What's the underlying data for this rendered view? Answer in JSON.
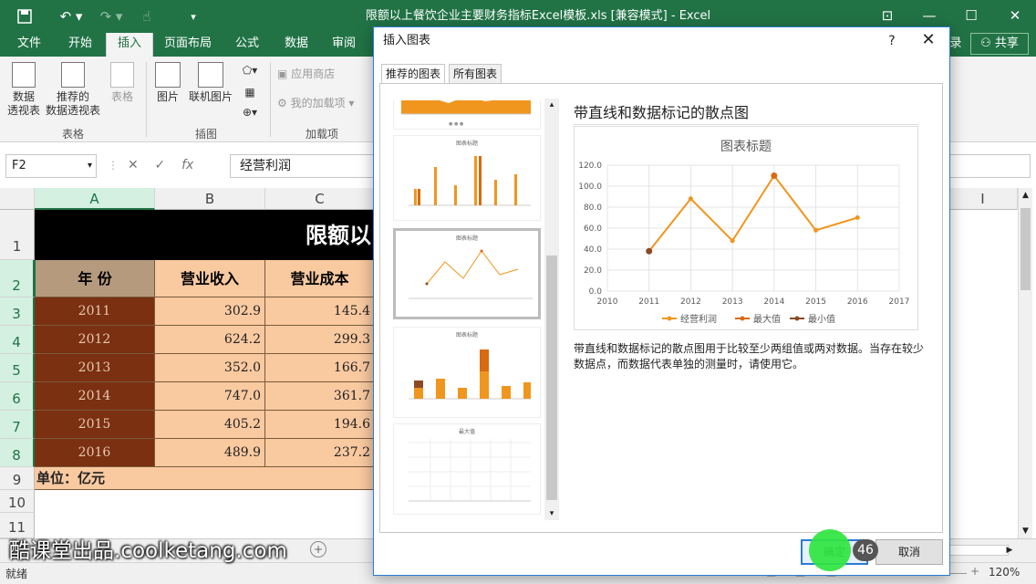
{
  "window": {
    "title": "限额以上餐饮企业主要财务指标Excel模板.xls  [兼容模式]  -  Excel",
    "share_label": "共享",
    "login_label": "录"
  },
  "ribbon": {
    "tabs": [
      "文件",
      "开始",
      "插入",
      "页面布局",
      "公式",
      "数据",
      "审阅"
    ],
    "active_tab": "插入",
    "buttons": {
      "pivot": "数据\n透视表",
      "recommended_pivot": "推荐的\n数据透视表",
      "table": "表格",
      "picture": "图片",
      "online_picture": "联机图片",
      "app_store": "应用商店",
      "my_addins": "我的加载项"
    },
    "groups": {
      "tables": "表格",
      "illustrations": "插图",
      "addins": "加载项"
    }
  },
  "formula_bar": {
    "name_box": "F2",
    "fx": "fx",
    "value": "经营利润"
  },
  "sheet": {
    "columns": [
      "A",
      "B",
      "C",
      "I"
    ],
    "rows": [
      "1",
      "2",
      "3",
      "4",
      "5",
      "6",
      "7",
      "8",
      "9",
      "10",
      "11"
    ],
    "title": "限额以",
    "headers": {
      "year": "年    份",
      "revenue": "营业收入",
      "cost": "营业成本"
    },
    "data": [
      {
        "year": "2011",
        "revenue": "302.9",
        "cost": "145.4"
      },
      {
        "year": "2012",
        "revenue": "624.2",
        "cost": "299.3"
      },
      {
        "year": "2013",
        "revenue": "352.0",
        "cost": "166.7"
      },
      {
        "year": "2014",
        "revenue": "747.0",
        "cost": "361.7"
      },
      {
        "year": "2015",
        "revenue": "405.2",
        "cost": "194.6"
      },
      {
        "year": "2016",
        "revenue": "489.9",
        "cost": "237.2"
      }
    ],
    "unit": "单位：亿元"
  },
  "status": {
    "ready": "就绪",
    "zoom": "120%"
  },
  "dialog": {
    "title": "插入图表",
    "help": "?",
    "close": "✕",
    "tabs": [
      "推荐的图表",
      "所有图表"
    ],
    "chart_name": "带直线和数据标记的散点图",
    "description": "带直线和数据标记的散点图用于比较至少两组值或两对数据。当存在较少数据点，而数据代表单独的测量时，请使用它。",
    "ok": "确定",
    "cancel": "取消",
    "thumb_titles": [
      "图表标题",
      "图表标题",
      "图表标题",
      "最大值"
    ]
  },
  "chart_data": {
    "type": "scatter",
    "title": "图表标题",
    "x": [
      2011,
      2012,
      2013,
      2014,
      2015,
      2016
    ],
    "series": [
      {
        "name": "经营利润",
        "values": [
          38,
          88,
          48,
          110,
          58,
          70
        ]
      }
    ],
    "legend": [
      "经营利润",
      "最大值",
      "最小值"
    ],
    "xlim": [
      2010,
      2017
    ],
    "ylim": [
      0,
      120
    ],
    "xticks": [
      "2010",
      "2011",
      "2012",
      "2013",
      "2014",
      "2015",
      "2016",
      "2017"
    ],
    "yticks": [
      "0.0",
      "20.0",
      "40.0",
      "60.0",
      "80.0",
      "100.0",
      "120.0"
    ],
    "legend_position": "bottom",
    "grid": true,
    "colors": {
      "line": "#f0961e",
      "max": "#d86a10",
      "min": "#8a4a24"
    }
  },
  "overlay": {
    "watermark": "酷课堂出品.coolketang.com",
    "step": "46"
  }
}
